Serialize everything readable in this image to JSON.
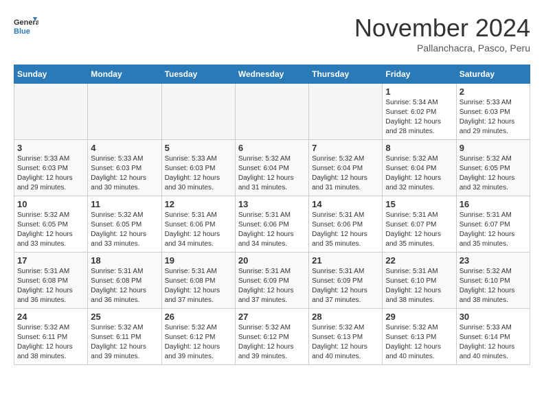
{
  "header": {
    "logo": {
      "general": "General",
      "blue": "Blue"
    },
    "title": "November 2024",
    "location": "Pallanchacra, Pasco, Peru"
  },
  "weekdays": [
    "Sunday",
    "Monday",
    "Tuesday",
    "Wednesday",
    "Thursday",
    "Friday",
    "Saturday"
  ],
  "weeks": [
    [
      {
        "day": "",
        "info": ""
      },
      {
        "day": "",
        "info": ""
      },
      {
        "day": "",
        "info": ""
      },
      {
        "day": "",
        "info": ""
      },
      {
        "day": "",
        "info": ""
      },
      {
        "day": "1",
        "info": "Sunrise: 5:34 AM\nSunset: 6:02 PM\nDaylight: 12 hours and 28 minutes."
      },
      {
        "day": "2",
        "info": "Sunrise: 5:33 AM\nSunset: 6:03 PM\nDaylight: 12 hours and 29 minutes."
      }
    ],
    [
      {
        "day": "3",
        "info": "Sunrise: 5:33 AM\nSunset: 6:03 PM\nDaylight: 12 hours and 29 minutes."
      },
      {
        "day": "4",
        "info": "Sunrise: 5:33 AM\nSunset: 6:03 PM\nDaylight: 12 hours and 30 minutes."
      },
      {
        "day": "5",
        "info": "Sunrise: 5:33 AM\nSunset: 6:03 PM\nDaylight: 12 hours and 30 minutes."
      },
      {
        "day": "6",
        "info": "Sunrise: 5:32 AM\nSunset: 6:04 PM\nDaylight: 12 hours and 31 minutes."
      },
      {
        "day": "7",
        "info": "Sunrise: 5:32 AM\nSunset: 6:04 PM\nDaylight: 12 hours and 31 minutes."
      },
      {
        "day": "8",
        "info": "Sunrise: 5:32 AM\nSunset: 6:04 PM\nDaylight: 12 hours and 32 minutes."
      },
      {
        "day": "9",
        "info": "Sunrise: 5:32 AM\nSunset: 6:05 PM\nDaylight: 12 hours and 32 minutes."
      }
    ],
    [
      {
        "day": "10",
        "info": "Sunrise: 5:32 AM\nSunset: 6:05 PM\nDaylight: 12 hours and 33 minutes."
      },
      {
        "day": "11",
        "info": "Sunrise: 5:32 AM\nSunset: 6:05 PM\nDaylight: 12 hours and 33 minutes."
      },
      {
        "day": "12",
        "info": "Sunrise: 5:31 AM\nSunset: 6:06 PM\nDaylight: 12 hours and 34 minutes."
      },
      {
        "day": "13",
        "info": "Sunrise: 5:31 AM\nSunset: 6:06 PM\nDaylight: 12 hours and 34 minutes."
      },
      {
        "day": "14",
        "info": "Sunrise: 5:31 AM\nSunset: 6:06 PM\nDaylight: 12 hours and 35 minutes."
      },
      {
        "day": "15",
        "info": "Sunrise: 5:31 AM\nSunset: 6:07 PM\nDaylight: 12 hours and 35 minutes."
      },
      {
        "day": "16",
        "info": "Sunrise: 5:31 AM\nSunset: 6:07 PM\nDaylight: 12 hours and 35 minutes."
      }
    ],
    [
      {
        "day": "17",
        "info": "Sunrise: 5:31 AM\nSunset: 6:08 PM\nDaylight: 12 hours and 36 minutes."
      },
      {
        "day": "18",
        "info": "Sunrise: 5:31 AM\nSunset: 6:08 PM\nDaylight: 12 hours and 36 minutes."
      },
      {
        "day": "19",
        "info": "Sunrise: 5:31 AM\nSunset: 6:08 PM\nDaylight: 12 hours and 37 minutes."
      },
      {
        "day": "20",
        "info": "Sunrise: 5:31 AM\nSunset: 6:09 PM\nDaylight: 12 hours and 37 minutes."
      },
      {
        "day": "21",
        "info": "Sunrise: 5:31 AM\nSunset: 6:09 PM\nDaylight: 12 hours and 37 minutes."
      },
      {
        "day": "22",
        "info": "Sunrise: 5:31 AM\nSunset: 6:10 PM\nDaylight: 12 hours and 38 minutes."
      },
      {
        "day": "23",
        "info": "Sunrise: 5:32 AM\nSunset: 6:10 PM\nDaylight: 12 hours and 38 minutes."
      }
    ],
    [
      {
        "day": "24",
        "info": "Sunrise: 5:32 AM\nSunset: 6:11 PM\nDaylight: 12 hours and 38 minutes."
      },
      {
        "day": "25",
        "info": "Sunrise: 5:32 AM\nSunset: 6:11 PM\nDaylight: 12 hours and 39 minutes."
      },
      {
        "day": "26",
        "info": "Sunrise: 5:32 AM\nSunset: 6:12 PM\nDaylight: 12 hours and 39 minutes."
      },
      {
        "day": "27",
        "info": "Sunrise: 5:32 AM\nSunset: 6:12 PM\nDaylight: 12 hours and 39 minutes."
      },
      {
        "day": "28",
        "info": "Sunrise: 5:32 AM\nSunset: 6:13 PM\nDaylight: 12 hours and 40 minutes."
      },
      {
        "day": "29",
        "info": "Sunrise: 5:32 AM\nSunset: 6:13 PM\nDaylight: 12 hours and 40 minutes."
      },
      {
        "day": "30",
        "info": "Sunrise: 5:33 AM\nSunset: 6:14 PM\nDaylight: 12 hours and 40 minutes."
      }
    ]
  ]
}
